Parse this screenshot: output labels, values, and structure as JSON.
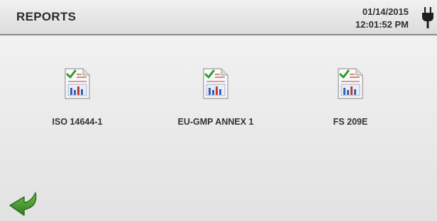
{
  "header": {
    "title": "REPORTS",
    "date": "01/14/2015",
    "time": "12:01:52 PM",
    "power_icon": "plug-icon"
  },
  "reports": [
    {
      "label": "ISO 14644-1",
      "icon": "report-document-icon"
    },
    {
      "label": "EU-GMP ANNEX 1",
      "icon": "report-document-icon"
    },
    {
      "label": "FS 209E",
      "icon": "report-document-icon"
    }
  ],
  "navigation": {
    "back_icon": "back-arrow-icon"
  },
  "colors": {
    "check_green": "#2e9b2e",
    "back_arrow_green": "#3f8f2a",
    "chart_blue": "#3b62b0",
    "chart_red": "#c0392b"
  }
}
